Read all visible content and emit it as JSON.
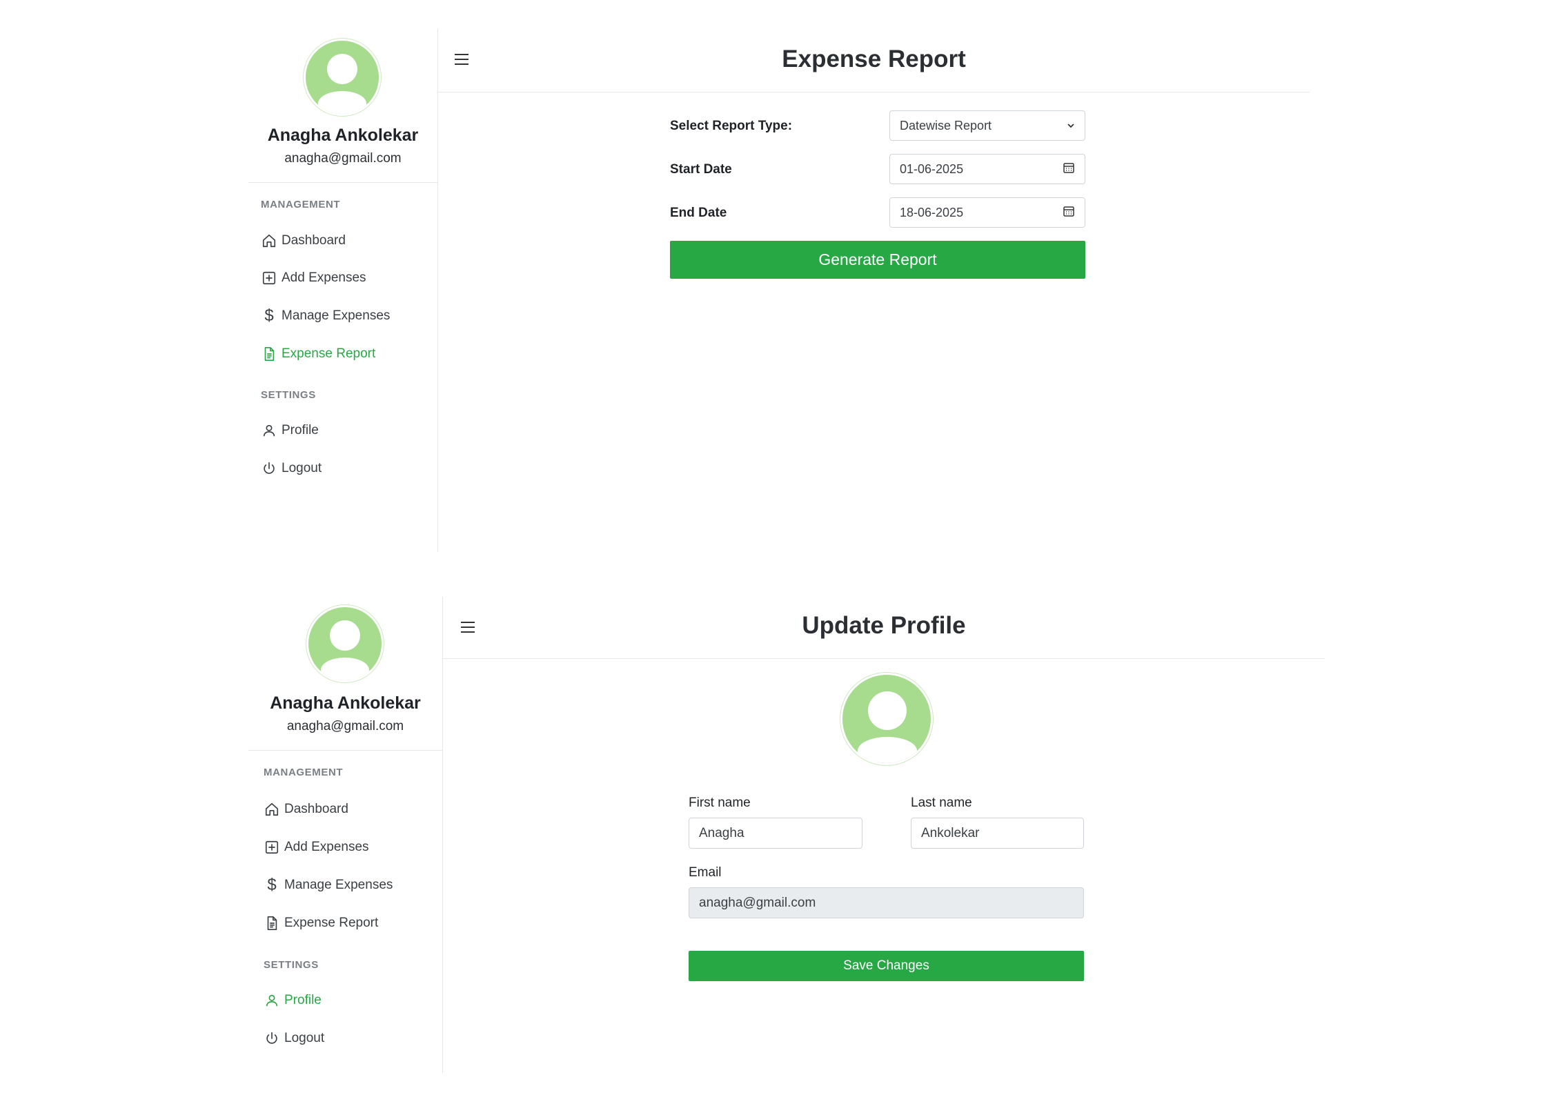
{
  "report_screen": {
    "sidebar": {
      "user_name": "Anagha Ankolekar",
      "user_email": "anagha@gmail.com",
      "management_label": "MANAGEMENT",
      "settings_label": "SETTINGS",
      "items": {
        "dashboard": "Dashboard",
        "add_expenses": "Add Expenses",
        "manage_expenses": "Manage Expenses",
        "expense_report": "Expense Report",
        "profile": "Profile",
        "logout": "Logout"
      },
      "active_item": "expense_report"
    },
    "header": {
      "title": "Expense Report"
    },
    "form": {
      "report_type_label": "Select Report Type:",
      "report_type_value": "Datewise Report",
      "start_date_label": "Start Date",
      "start_date_value": "01-06-2025",
      "end_date_label": "End Date",
      "end_date_value": "18-06-2025",
      "generate_button": "Generate Report"
    }
  },
  "profile_screen": {
    "sidebar": {
      "user_name": "Anagha Ankolekar",
      "user_email": "anagha@gmail.com",
      "management_label": "MANAGEMENT",
      "settings_label": "SETTINGS",
      "items": {
        "dashboard": "Dashboard",
        "add_expenses": "Add Expenses",
        "manage_expenses": "Manage Expenses",
        "expense_report": "Expense Report",
        "profile": "Profile",
        "logout": "Logout"
      },
      "active_item": "profile"
    },
    "header": {
      "title": "Update Profile"
    },
    "form": {
      "first_name_label": "First name",
      "first_name_value": "Anagha",
      "last_name_label": "Last name",
      "last_name_value": "Ankolekar",
      "email_label": "Email",
      "email_value": "anagha@gmail.com",
      "save_button": "Save Changes"
    }
  },
  "colors": {
    "accent": "#28a745",
    "avatar": "#a7dc8f",
    "disabled_input": "#e9ecef"
  }
}
